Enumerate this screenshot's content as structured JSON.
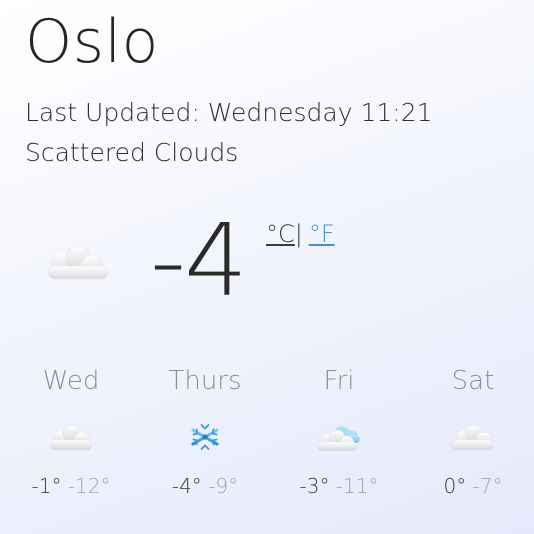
{
  "location": {
    "city": "Oslo"
  },
  "status": {
    "last_updated": "Last Updated: Wednesday 11:21",
    "description": "Scattered Clouds"
  },
  "current": {
    "temperature": "-4",
    "icon": "cloud-icon",
    "unit_celsius": "°C",
    "unit_separator": "|",
    "unit_fahrenheit": "°F"
  },
  "forecast": [
    {
      "day": "Wed",
      "icon": "cloud-icon",
      "high": "-1°",
      "low": "-12°"
    },
    {
      "day": "Thurs",
      "icon": "snowflake-icon",
      "high": "-4°",
      "low": "-9°"
    },
    {
      "day": "Fri",
      "icon": "cloud-sun-icon",
      "high": "-3°",
      "low": "-11°"
    },
    {
      "day": "Sat",
      "icon": "cloud-icon",
      "high": "0°",
      "low": "-7°"
    }
  ],
  "colors": {
    "link_blue": "#4a8fd8",
    "muted_gray": "#8e8e96",
    "text_dark": "#2a2a2a"
  }
}
